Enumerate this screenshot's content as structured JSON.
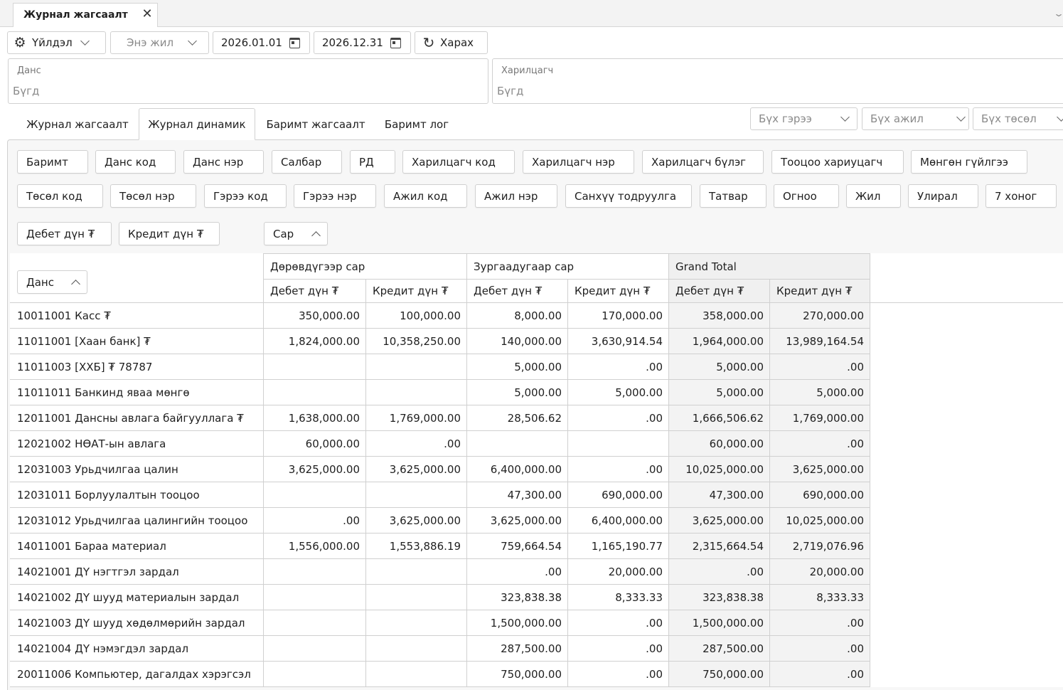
{
  "window": {
    "doc_tab_label": "Журнал жагсаалт"
  },
  "toolbar": {
    "actions_label": "Үйлдэл",
    "period_label": "Энэ жил",
    "date_from": "2026.01.01",
    "date_to": "2026.12.31",
    "view_label": "Харах"
  },
  "filters": {
    "account_label": "Данс",
    "account_value": "Бүгд",
    "partner_label": "Харилцагч",
    "partner_value": "Бүгд"
  },
  "tabs": [
    {
      "label": "Журнал жагсаалт",
      "active": false
    },
    {
      "label": "Журнал динамик",
      "active": true
    },
    {
      "label": "Баримт жагсаалт",
      "active": false
    },
    {
      "label": "Баримт лог",
      "active": false
    }
  ],
  "selects": {
    "contract": "Бүх гэрээ",
    "job": "Бүх ажил",
    "project": "Бүх төсөл"
  },
  "field_chips": {
    "row1": [
      "Баримт",
      "Данс код",
      "Данс нэр",
      "Салбар",
      "РД",
      "Харилцагч код",
      "Харилцагч нэр",
      "Харилцагч бүлэг",
      "Тооцоо хариуцагч",
      "Мөнгөн гүйлгээ"
    ],
    "row2": [
      "Төсөл код",
      "Төсөл нэр",
      "Гэрээ код",
      "Гэрээ нэр",
      "Ажил код",
      "Ажил нэр",
      "Санхүү тодруулга",
      "Татвар",
      "Огноо",
      "Жил",
      "Улирал",
      "7 хоног"
    ],
    "data_fields": [
      "Дебет дүн ₮",
      "Кредит дүн ₮"
    ],
    "column_field": "Сар",
    "row_field": "Данс"
  },
  "pivot": {
    "column_groups": [
      "Дөрөвдүгээр сар",
      "Зургаадугаар сар",
      "Grand Total"
    ],
    "measure_headers": [
      "Дебет дүн ₮",
      "Кредит дүн ₮",
      "Дебет дүн ₮",
      "Кредит дүн ₮",
      "Дебет дүн ₮",
      "Кредит дүн ₮"
    ],
    "rows": [
      {
        "account": "10011001 Касс ₮",
        "values": [
          "350,000.00",
          "100,000.00",
          "8,000.00",
          "170,000.00",
          "358,000.00",
          "270,000.00"
        ]
      },
      {
        "account": "11011001 [Хаан банк] ₮",
        "values": [
          "1,824,000.00",
          "10,358,250.00",
          "140,000.00",
          "3,630,914.54",
          "1,964,000.00",
          "13,989,164.54"
        ]
      },
      {
        "account": "11011003 [ХХБ] ₮ 78787",
        "values": [
          "",
          "",
          "5,000.00",
          ".00",
          "5,000.00",
          ".00"
        ]
      },
      {
        "account": "11011011 Банкинд яваа мөнгө",
        "values": [
          "",
          "",
          "5,000.00",
          "5,000.00",
          "5,000.00",
          "5,000.00"
        ]
      },
      {
        "account": "12011001 Дансны авлага байгууллага ₮",
        "values": [
          "1,638,000.00",
          "1,769,000.00",
          "28,506.62",
          ".00",
          "1,666,506.62",
          "1,769,000.00"
        ]
      },
      {
        "account": "12021002 НӨАТ-ын авлага",
        "values": [
          "60,000.00",
          ".00",
          "",
          "",
          "60,000.00",
          ".00"
        ]
      },
      {
        "account": "12031003 Урьдчилгаа цалин",
        "values": [
          "3,625,000.00",
          "3,625,000.00",
          "6,400,000.00",
          ".00",
          "10,025,000.00",
          "3,625,000.00"
        ]
      },
      {
        "account": "12031011 Борлуулалтын тооцоо",
        "values": [
          "",
          "",
          "47,300.00",
          "690,000.00",
          "47,300.00",
          "690,000.00"
        ]
      },
      {
        "account": "12031012 Урьдчилгаа цалингийн тооцоо",
        "values": [
          ".00",
          "3,625,000.00",
          "3,625,000.00",
          "6,400,000.00",
          "3,625,000.00",
          "10,025,000.00"
        ]
      },
      {
        "account": "14011001 Бараа материал",
        "values": [
          "1,556,000.00",
          "1,553,886.19",
          "759,664.54",
          "1,165,190.77",
          "2,315,664.54",
          "2,719,076.96"
        ]
      },
      {
        "account": "14021001 ДҮ нэгтгэл зардал",
        "values": [
          "",
          "",
          ".00",
          "20,000.00",
          ".00",
          "20,000.00"
        ]
      },
      {
        "account": "14021002 ДҮ шууд материалын зардал",
        "values": [
          "",
          "",
          "323,838.38",
          "8,333.33",
          "323,838.38",
          "8,333.33"
        ]
      },
      {
        "account": "14021003 ДҮ шууд хөдөлмөрийн зардал",
        "values": [
          "",
          "",
          "1,500,000.00",
          ".00",
          "1,500,000.00",
          ".00"
        ]
      },
      {
        "account": "14021004 ДҮ нэмэгдэл зардал",
        "values": [
          "",
          "",
          "287,500.00",
          ".00",
          "287,500.00",
          ".00"
        ]
      },
      {
        "account": "20011006 Компьютер, дагалдах хэрэгсэл",
        "values": [
          "",
          "",
          "750,000.00",
          ".00",
          "750,000.00",
          ".00"
        ]
      }
    ]
  }
}
